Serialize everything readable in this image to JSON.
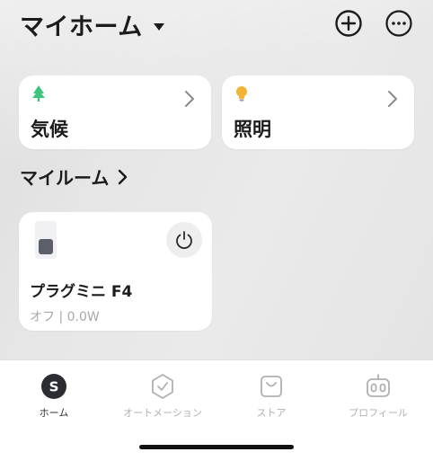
{
  "header": {
    "home_name": "マイホーム",
    "icons": {
      "add": "add-circle-icon",
      "more": "more-dots-icon",
      "dropdown": "caret-down-icon"
    }
  },
  "categories": [
    {
      "label": "気候",
      "icon": "tree-icon"
    },
    {
      "label": "照明",
      "icon": "light-bulb-icon"
    }
  ],
  "section": {
    "title": "マイルーム"
  },
  "device": {
    "name": "プラグミニ F4",
    "status": "オフ | 0.0W",
    "icon": "plug-icon"
  },
  "tabs": [
    {
      "label": "ホーム",
      "icon": "home-s-icon",
      "active": true
    },
    {
      "label": "オートメーション",
      "icon": "automation-icon",
      "active": false
    },
    {
      "label": "ストア",
      "icon": "store-bag-icon",
      "active": false
    },
    {
      "label": "プロフィール",
      "icon": "robot-profile-icon",
      "active": false
    }
  ],
  "colors": {
    "card": "#ffffff",
    "text": "#1b1b1b",
    "muted": "#a8a8a8",
    "tree": "#3fc47f",
    "bulb": "#f3b338"
  }
}
